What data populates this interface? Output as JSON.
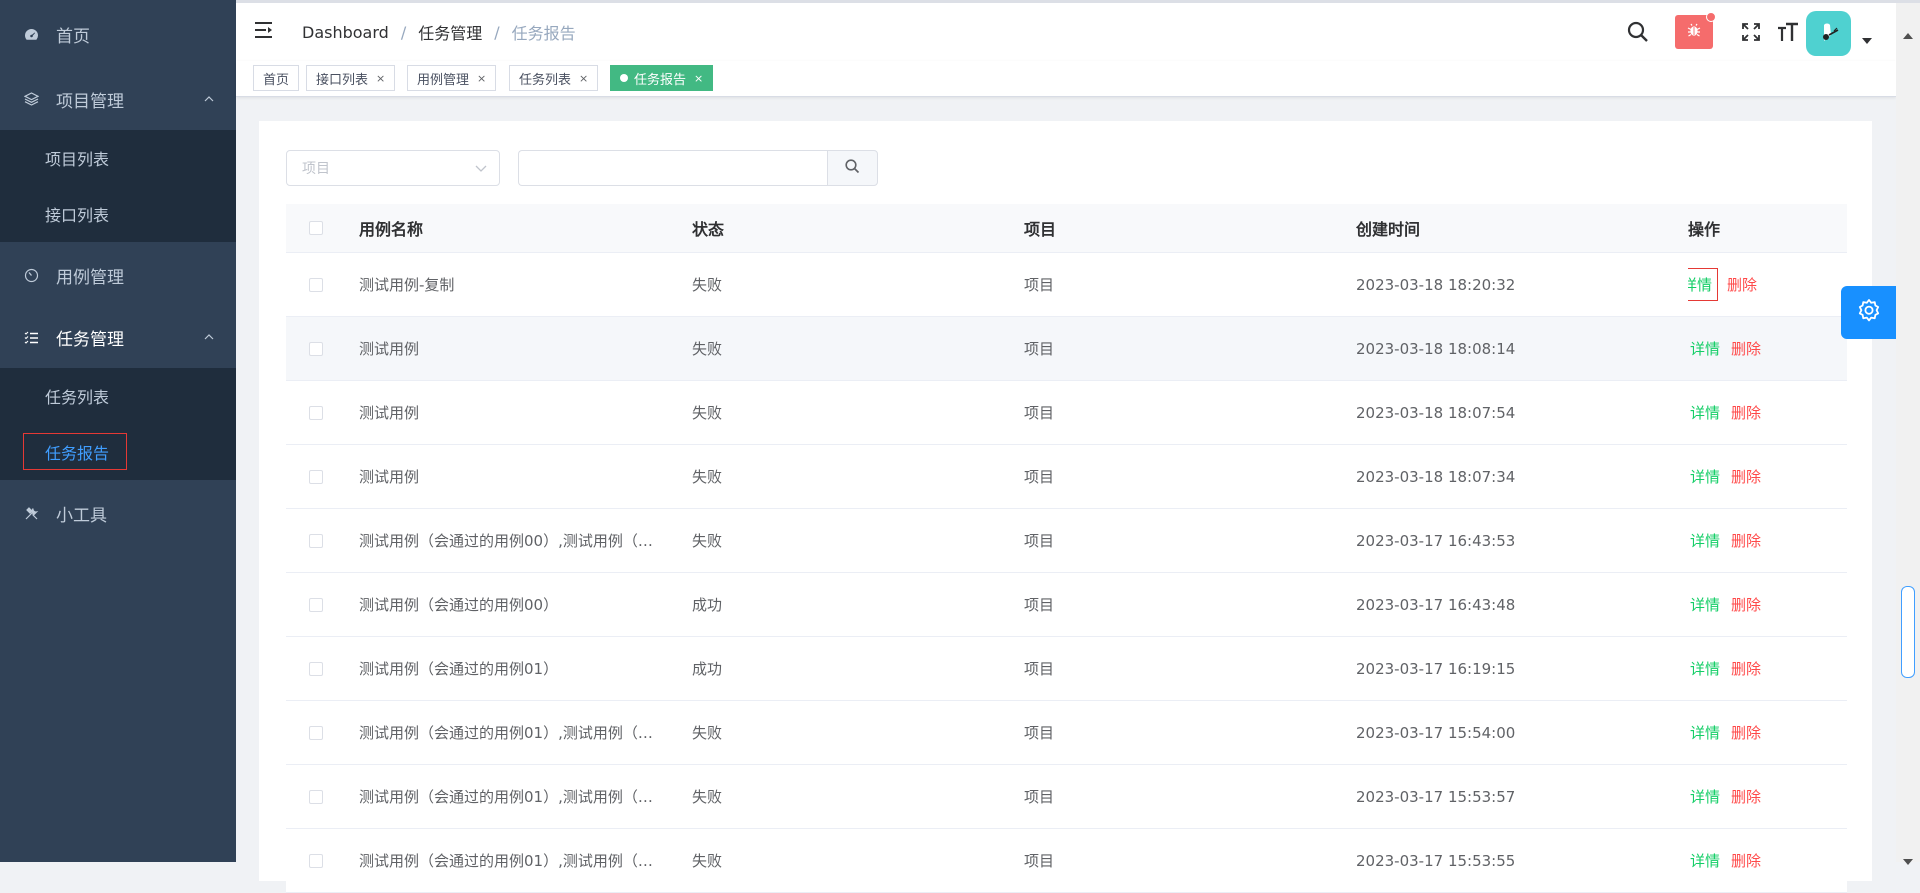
{
  "sidebar": {
    "items": [
      {
        "label": "首页",
        "icon": "dashboard-icon"
      },
      {
        "label": "项目管理",
        "icon": "layers-icon",
        "expanded": true,
        "children": [
          {
            "label": "项目列表"
          },
          {
            "label": "接口列表"
          }
        ]
      },
      {
        "label": "用例管理",
        "icon": "gauge-icon"
      },
      {
        "label": "任务管理",
        "icon": "list-check-icon",
        "expanded": true,
        "children": [
          {
            "label": "任务列表"
          },
          {
            "label": "任务报告",
            "active": true
          }
        ]
      },
      {
        "label": "小工具",
        "icon": "tools-icon"
      }
    ]
  },
  "navbar": {
    "breadcrumb": [
      "Dashboard",
      "任务管理",
      "任务报告"
    ],
    "separator": "/"
  },
  "tags": [
    {
      "label": "首页",
      "closable": false
    },
    {
      "label": "接口列表",
      "closable": true
    },
    {
      "label": "用例管理",
      "closable": true
    },
    {
      "label": "任务列表",
      "closable": true
    },
    {
      "label": "任务报告",
      "closable": true,
      "active": true
    }
  ],
  "tag_close": "×",
  "filters": {
    "project_placeholder": "项目",
    "search_placeholder": ""
  },
  "table": {
    "headers": {
      "name": "用例名称",
      "status": "状态",
      "project": "项目",
      "created": "创建时间",
      "ops": "操作"
    },
    "ops": {
      "detail": "详情",
      "delete": "删除"
    },
    "rows": [
      {
        "name": "测试用例-复制",
        "status": "失败",
        "project": "项目",
        "created": "2023-03-18 18:20:32"
      },
      {
        "name": "测试用例",
        "status": "失败",
        "project": "项目",
        "created": "2023-03-18 18:08:14"
      },
      {
        "name": "测试用例",
        "status": "失败",
        "project": "项目",
        "created": "2023-03-18 18:07:54"
      },
      {
        "name": "测试用例",
        "status": "失败",
        "project": "项目",
        "created": "2023-03-18 18:07:34"
      },
      {
        "name": "测试用例（会通过的用例00）,测试用例（…",
        "status": "失败",
        "project": "项目",
        "created": "2023-03-17 16:43:53"
      },
      {
        "name": "测试用例（会通过的用例00）",
        "status": "成功",
        "project": "项目",
        "created": "2023-03-17 16:43:48"
      },
      {
        "name": "测试用例（会通过的用例01）",
        "status": "成功",
        "project": "项目",
        "created": "2023-03-17 16:19:15"
      },
      {
        "name": "测试用例（会通过的用例01）,测试用例（…",
        "status": "失败",
        "project": "项目",
        "created": "2023-03-17 15:54:00"
      },
      {
        "name": "测试用例（会通过的用例01）,测试用例（…",
        "status": "失败",
        "project": "项目",
        "created": "2023-03-17 15:53:57"
      },
      {
        "name": "测试用例（会通过的用例01）,测试用例（…",
        "status": "失败",
        "project": "项目",
        "created": "2023-03-17 15:53:55"
      }
    ]
  },
  "colors": {
    "sidebar_bg": "#304156",
    "submenu_bg": "#1f2d3d",
    "active_link": "#409eff",
    "tag_active": "#42b983",
    "op_detail": "#13ce66",
    "op_delete": "#ff4949",
    "bug_btn": "#f56c6c",
    "settings_btn": "#1890ff"
  }
}
